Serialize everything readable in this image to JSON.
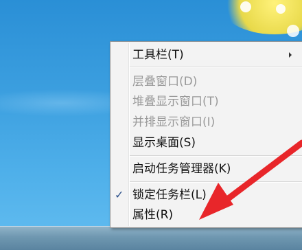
{
  "context_menu": {
    "items": [
      {
        "label": "工具栏(T)"
      },
      {
        "label": "层叠窗口(D)"
      },
      {
        "label": "堆叠显示窗口(T)"
      },
      {
        "label": "并排显示窗口(I)"
      },
      {
        "label": "显示桌面(S)"
      },
      {
        "label": "启动任务管理器(K)"
      },
      {
        "label": "锁定任务栏(L)"
      },
      {
        "label": "属性(R)"
      }
    ],
    "checkmark": "✓"
  },
  "colors": {
    "annotation_arrow": "#e8262a",
    "desktop_blue": "#3da0e0"
  },
  "icons": {
    "submenu": "chevron-right-icon",
    "check": "checkmark-icon"
  }
}
